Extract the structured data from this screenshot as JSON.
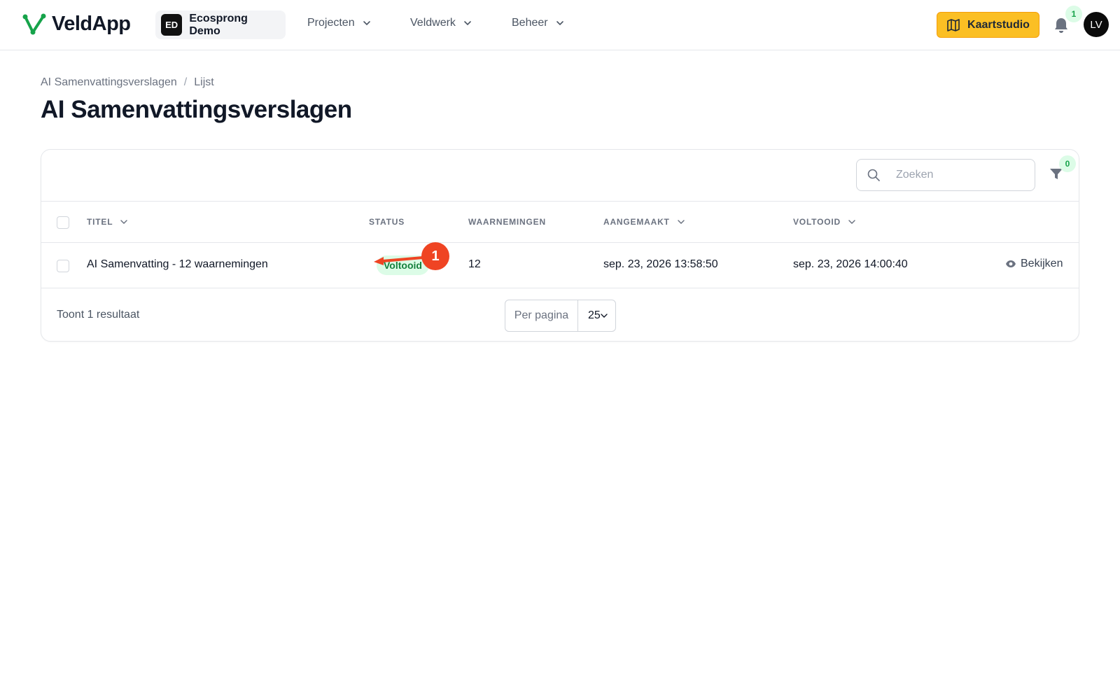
{
  "app": {
    "name": "VeldApp"
  },
  "org": {
    "initials": "ED",
    "name": "Ecosprong Demo"
  },
  "nav": {
    "items": [
      {
        "label": "Projecten"
      },
      {
        "label": "Veldwerk"
      },
      {
        "label": "Beheer"
      }
    ]
  },
  "header_actions": {
    "studio_label": "Kaartstudio",
    "notifications_count": "1",
    "user_initials": "LV"
  },
  "breadcrumb": {
    "parent": "AI Samenvattingsverslagen",
    "separator": "/",
    "current": "Lijst"
  },
  "page": {
    "title": "AI Samenvattingsverslagen"
  },
  "table": {
    "search_placeholder": "Zoeken",
    "filter_count": "0",
    "columns": {
      "title": "TITEL",
      "status": "STATUS",
      "observations": "WAARNEMINGEN",
      "created": "AANGEMAAKT",
      "completed": "VOLTOOID"
    },
    "rows": [
      {
        "title": "AI Samenvatting - 12 waarnemingen",
        "status": "Voltooid",
        "observations": "12",
        "created": "sep. 23, 2026 13:58:50",
        "completed": "sep. 23, 2026 14:00:40",
        "action": "Bekijken"
      }
    ],
    "result_text": "Toont 1 resultaat",
    "per_page_label": "Per pagina",
    "per_page_value": "25"
  },
  "annotation": {
    "step": "1",
    "color": "#ef4423"
  },
  "colors": {
    "accent": "#fbbf24",
    "success_bg": "#dcfce7",
    "success_text": "#15803d",
    "brand_green": "#16a34a"
  }
}
